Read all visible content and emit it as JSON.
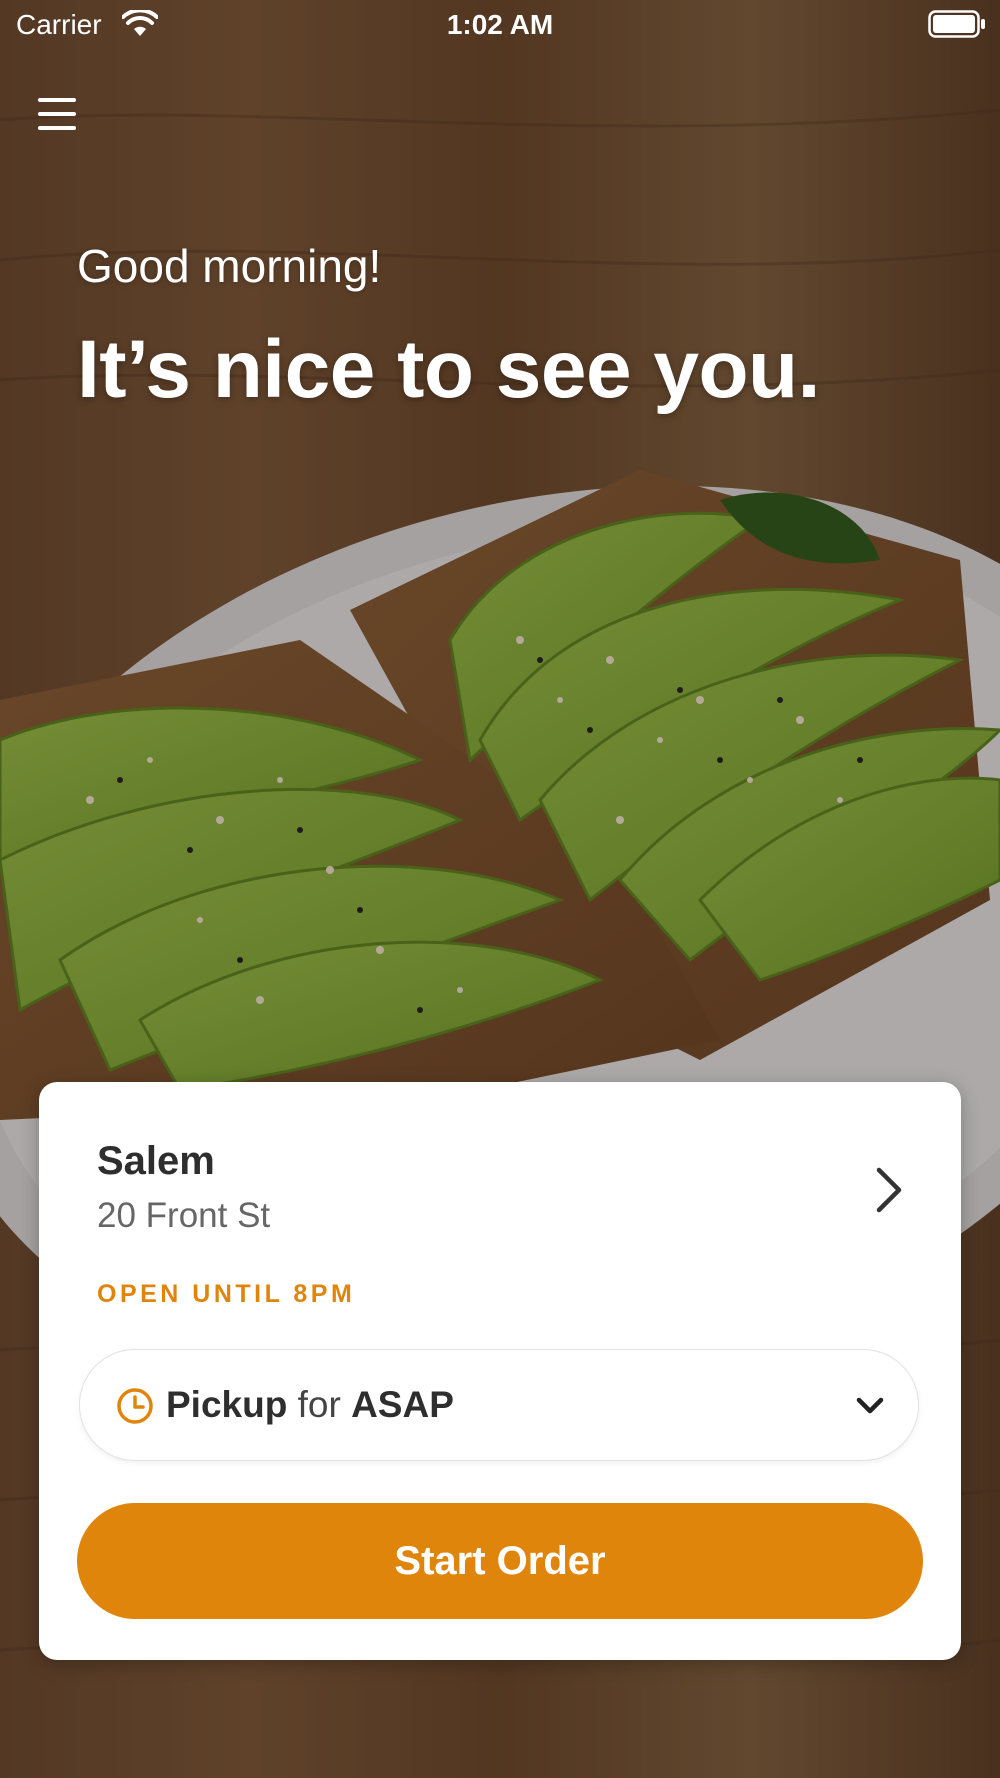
{
  "status_bar": {
    "carrier": "Carrier",
    "time": "1:02 AM"
  },
  "icons": {
    "menu": "hamburger-menu-icon",
    "wifi": "wifi-icon",
    "battery": "battery-icon",
    "location_chevron": "chevron-right-icon",
    "pickup_clock": "clock-icon",
    "pickup_chevron": "chevron-down-icon"
  },
  "hero": {
    "greeting": "Good morning!",
    "headline": "It’s nice to see you."
  },
  "location_card": {
    "name": "Salem",
    "address": "20 Front St",
    "hours": "OPEN UNTIL 8PM",
    "pickup": {
      "method": "Pickup",
      "connector": "for",
      "time": "ASAP"
    },
    "start_order_label": "Start Order"
  },
  "colors": {
    "accent": "#e0850c",
    "card_background": "#ffffff",
    "text_primary": "#2e2e2e",
    "text_secondary": "#666666"
  }
}
